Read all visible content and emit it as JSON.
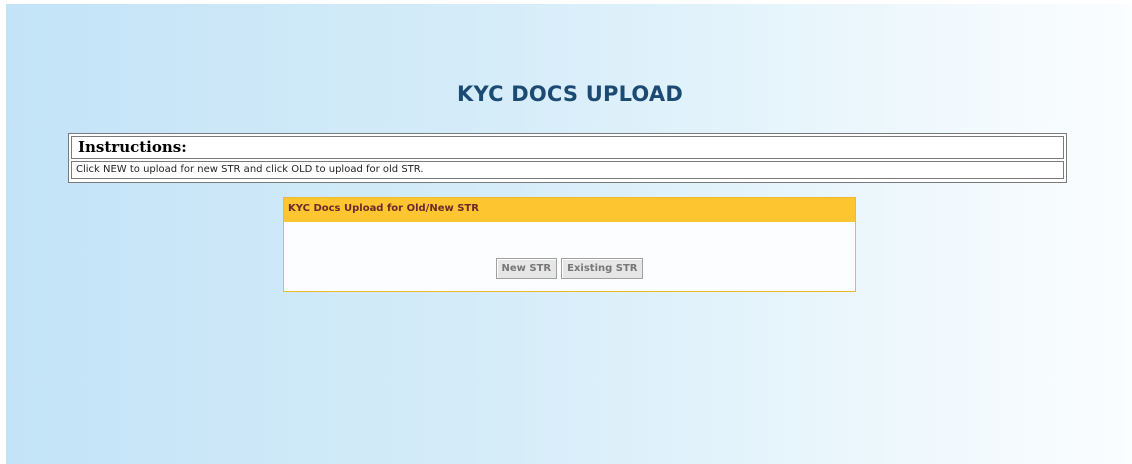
{
  "page": {
    "title": "KYC DOCS UPLOAD"
  },
  "instructions": {
    "heading": "Instructions:",
    "text": "Click NEW to upload for new STR and click OLD to upload for old STR."
  },
  "upload_panel": {
    "header": "KYC Docs Upload for Old/New STR",
    "buttons": {
      "new_label": "New STR",
      "existing_label": "Existing STR"
    }
  },
  "colors": {
    "title": "#1b4a73",
    "panel_header_bg": "#fdc52f",
    "panel_header_text": "#6b2a2a",
    "panel_border": "#f0b92a"
  }
}
